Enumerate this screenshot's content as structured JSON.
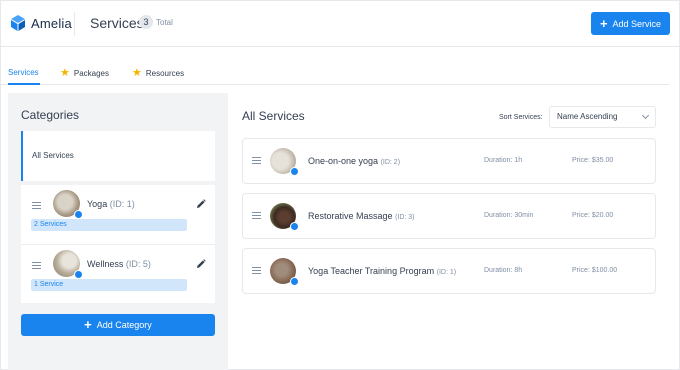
{
  "brand": {
    "name": "Amelia",
    "accent": "#1a84ee"
  },
  "header": {
    "title": "Services",
    "count": "3",
    "total_label": "Total",
    "add_service_label": "Add Service"
  },
  "tabs": [
    {
      "label": "Services",
      "active": true,
      "icon": null
    },
    {
      "label": "Packages",
      "active": false,
      "icon": "star-icon"
    },
    {
      "label": "Resources",
      "active": false,
      "icon": "star-icon"
    }
  ],
  "categories": {
    "title": "Categories",
    "all_label": "All Services",
    "items": [
      {
        "name": "Yoga",
        "id": "(ID: 1)",
        "count": "2 Services"
      },
      {
        "name": "Wellness",
        "id": "(ID: 5)",
        "count": "1 Service"
      }
    ],
    "add_label": "Add Category"
  },
  "services": {
    "title": "All Services",
    "sort_label": "Sort Services:",
    "sort_value": "Name Ascending",
    "items": [
      {
        "name": "One-on-one yoga",
        "id": "(ID: 2)",
        "duration": "Duration: 1h",
        "price": "Price: $35.00"
      },
      {
        "name": "Restorative Massage",
        "id": "(ID: 3)",
        "duration": "Duration: 30min",
        "price": "Price: $20.00"
      },
      {
        "name": "Yoga Teacher Training Program",
        "id": "(ID: 1)",
        "duration": "Duration: 8h",
        "price": "Price: $100.00"
      }
    ]
  }
}
